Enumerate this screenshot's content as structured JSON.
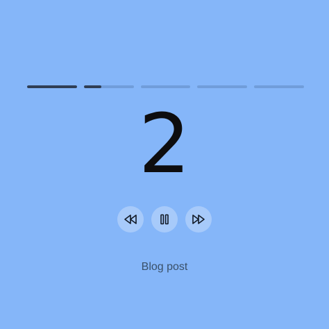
{
  "colors": {
    "background": "#85b6f9",
    "progress_active": "#2f3e55",
    "progress_track": "rgba(40,70,110,0.22)",
    "digit": "#0d0d0f",
    "caption": "#3a5068"
  },
  "progress": {
    "segments": [
      {
        "fill": 1.0
      },
      {
        "fill": 0.35
      },
      {
        "fill": 0
      },
      {
        "fill": 0
      },
      {
        "fill": 0
      }
    ]
  },
  "current_number": "2",
  "controls": {
    "rewind_icon": "rewind-icon",
    "pause_icon": "pause-icon",
    "fast_forward_icon": "fast-forward-icon"
  },
  "caption": "Blog post"
}
